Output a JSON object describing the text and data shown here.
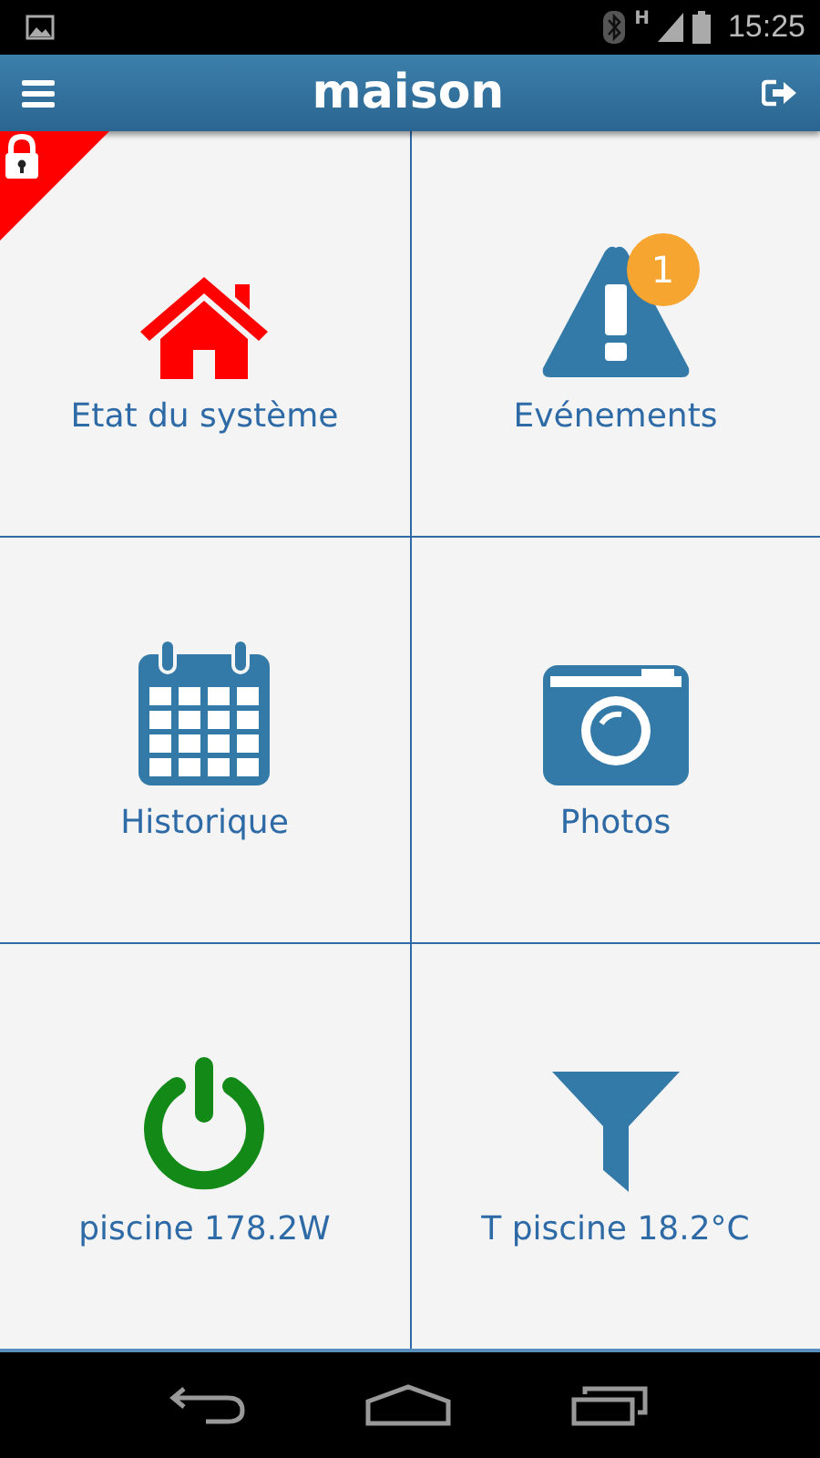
{
  "status_bar": {
    "time": "15:25",
    "network": "H"
  },
  "app_bar": {
    "title": "maison"
  },
  "security": {
    "locked": true
  },
  "events_badge": "1",
  "tiles": [
    {
      "kind": "home",
      "label": "Etat du système"
    },
    {
      "kind": "alert",
      "label": "Evénements"
    },
    {
      "kind": "calendar",
      "label": "Historique"
    },
    {
      "kind": "camera",
      "label": "Photos"
    },
    {
      "kind": "power",
      "label": "piscine 178.2W"
    },
    {
      "kind": "filter",
      "label": "T piscine 18.2°C"
    }
  ]
}
